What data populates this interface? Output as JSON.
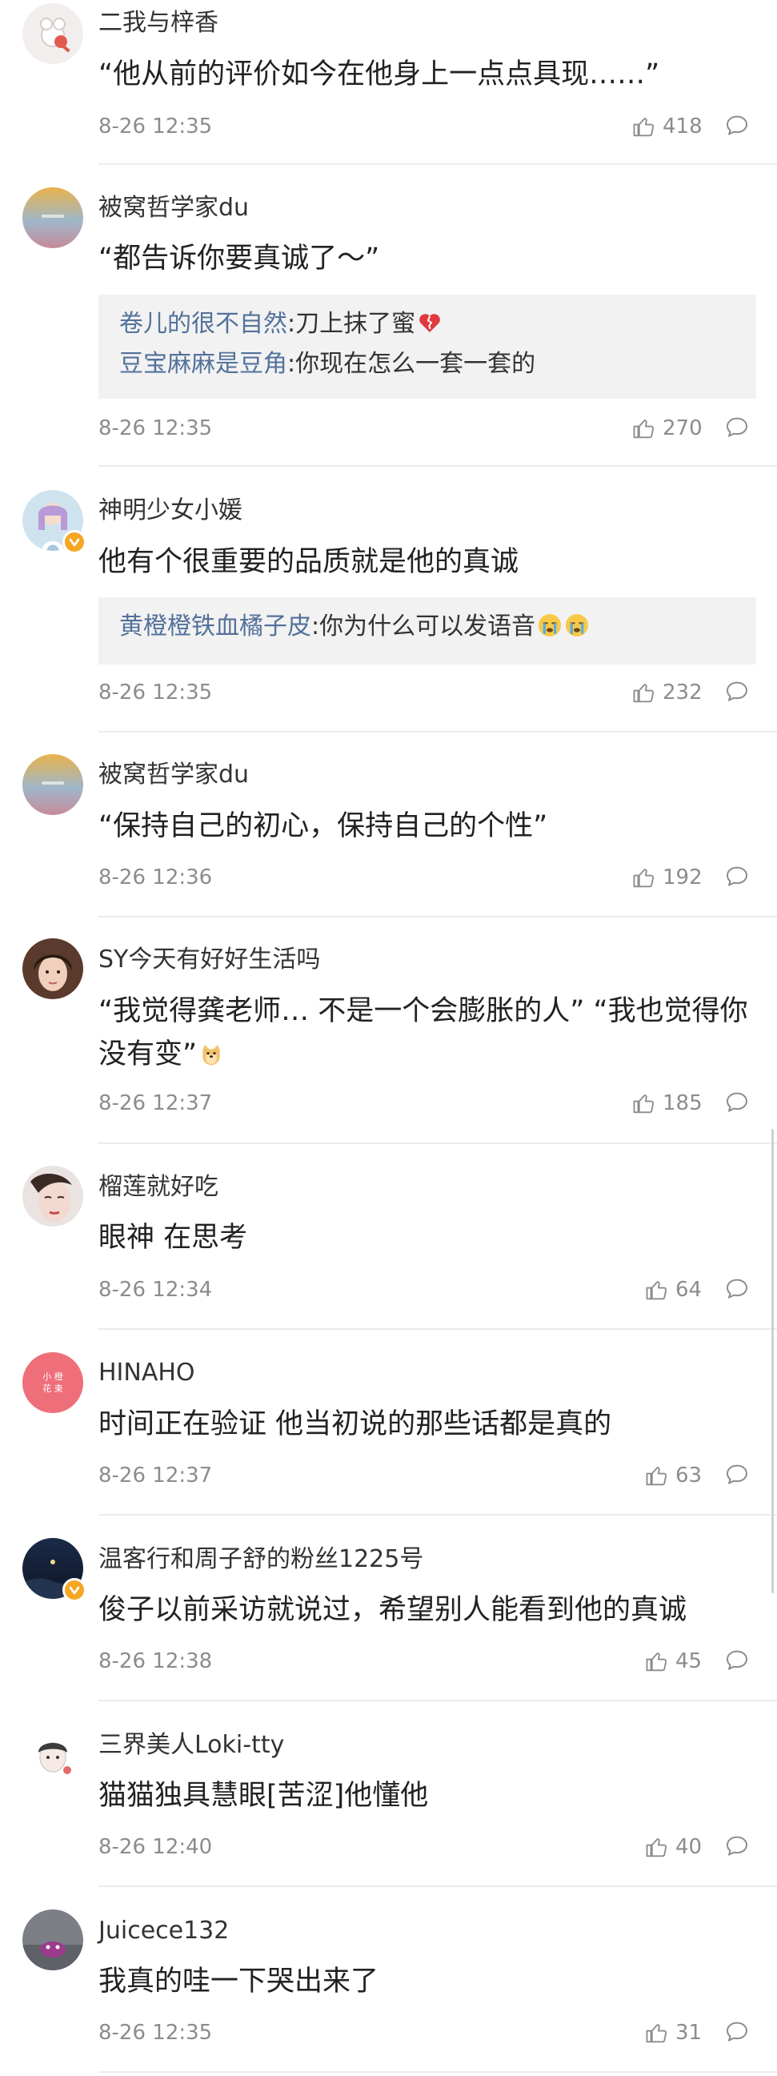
{
  "comments": [
    {
      "user": "二我与梓香",
      "text": "“他从前的评价如今在他身上一点点具现……”",
      "time": "8-26 12:35",
      "likes": "418"
    },
    {
      "user": "被窝哲学家du",
      "text": "“都告诉你要真诚了～”",
      "replies": [
        {
          "name": "卷儿的很不自然",
          "text": ":刀上抹了蜜"
        },
        {
          "name": "豆宝麻麻是豆角",
          "text": ":你现在怎么一套一套的"
        }
      ],
      "time": "8-26 12:35",
      "likes": "270"
    },
    {
      "user": "神明少女小媛",
      "text": "他有个很重要的品质就是他的真诚",
      "replies": [
        {
          "name": "黄橙橙铁血橘子皮",
          "text": ":你为什么可以发语音"
        }
      ],
      "time": "8-26 12:35",
      "likes": "232"
    },
    {
      "user": "被窝哲学家du",
      "text": "“保持自己的初心，保持自己的个性”",
      "time": "8-26 12:36",
      "likes": "192"
    },
    {
      "user": "SY今天有好好生活吗",
      "text": "“我觉得龚老师… 不是一个会膨胀的人” “我也觉得你没有变”",
      "time": "8-26 12:37",
      "likes": "185"
    },
    {
      "user": "榴莲就好吃",
      "text": "眼神 在思考",
      "time": "8-26 12:34",
      "likes": "64"
    },
    {
      "user": "HINAHO",
      "avatar_text": "小 橙\n花 束",
      "text": "时间正在验证 他当初说的那些话都是真的",
      "time": "8-26 12:37",
      "likes": "63"
    },
    {
      "user": "温客行和周子舒的粉丝1225号",
      "text": "俊子以前采访就说过，希望别人能看到他的真诚",
      "time": "8-26 12:38",
      "likes": "45"
    },
    {
      "user": "三界美人Loki-tty",
      "text": "猫猫独具慧眼[苦涩]他懂他",
      "time": "8-26 12:40",
      "likes": "40"
    },
    {
      "user": "Juicece132",
      "text": "我真的哇一下哭出来了",
      "time": "8-26 12:35",
      "likes": "31"
    }
  ],
  "icons": {
    "like": "thumbs-up-icon",
    "comment": "speech-bubble-icon",
    "verified": "verified-badge-icon",
    "emoji_heartbreak": "broken-heart-emoji",
    "emoji_cry": "crying-face-emoji",
    "emoji_doge": "doge-emoji"
  },
  "colors": {
    "reply_name": "#53719b",
    "meta_gray": "#8c8c8c",
    "reply_bg": "#f2f2f2",
    "divider": "#ececec",
    "verified": "#f5a623"
  }
}
